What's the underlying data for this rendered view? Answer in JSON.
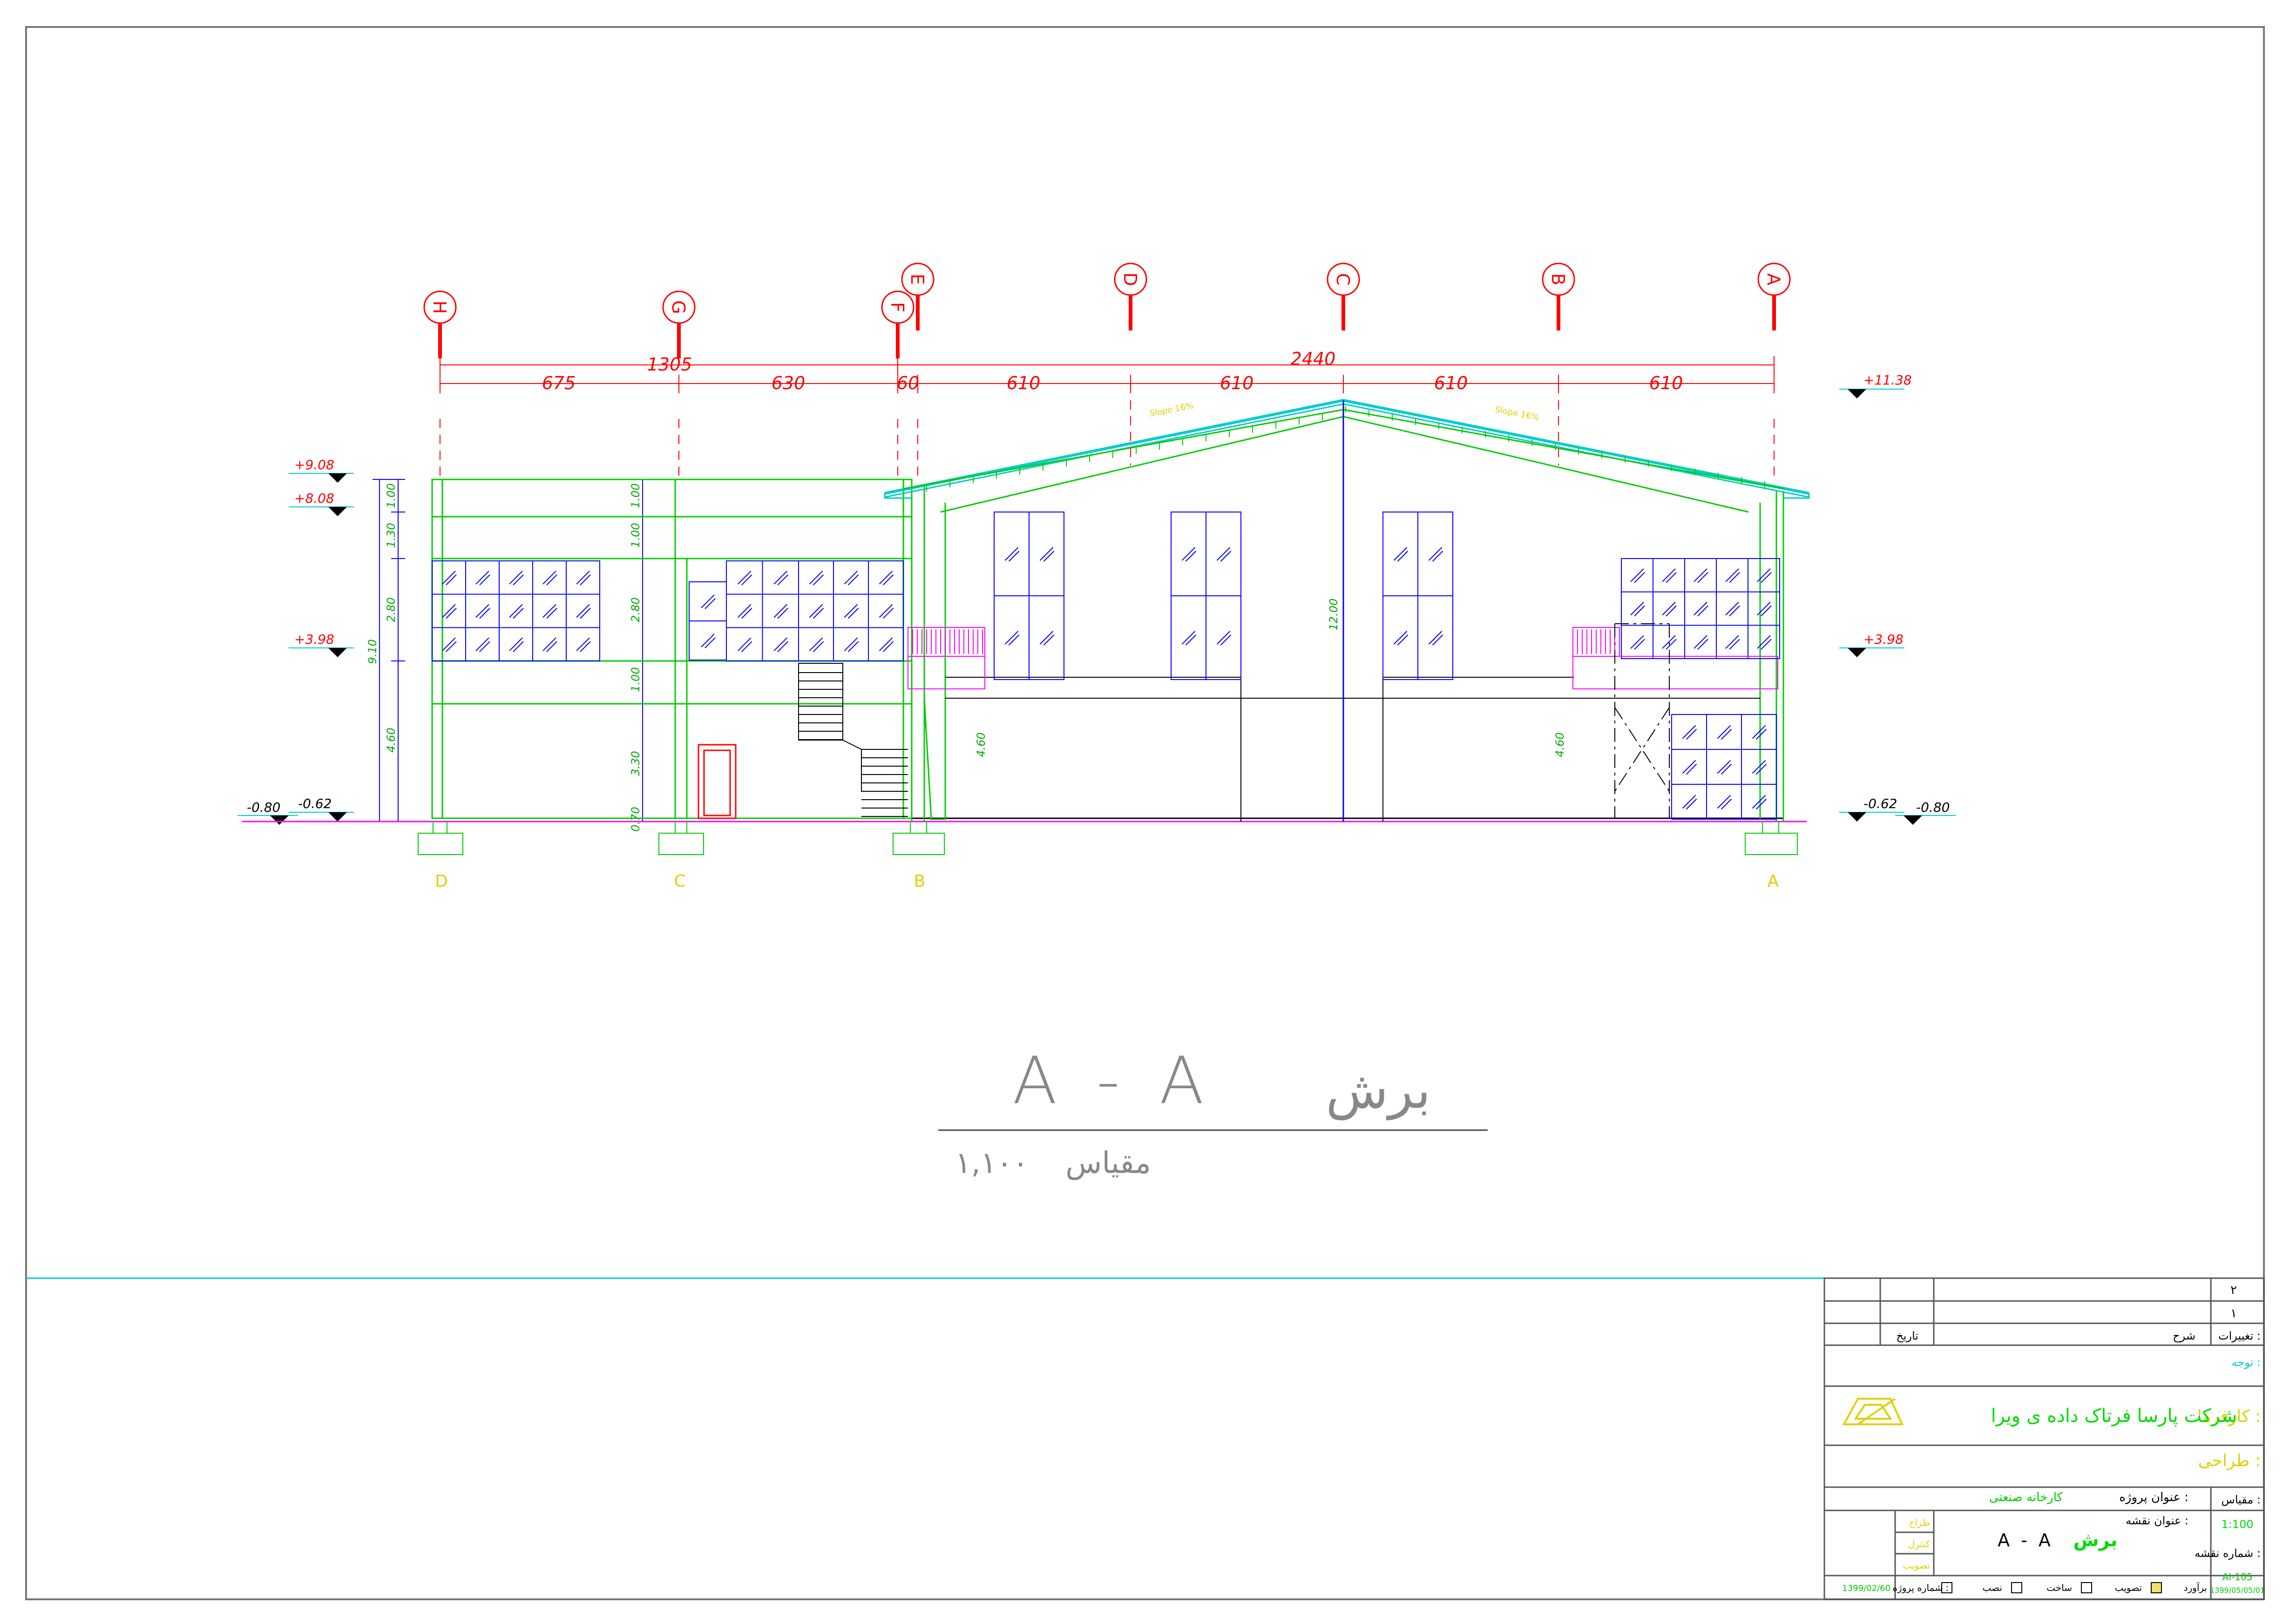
{
  "grid_top": [
    {
      "id": "grid-h",
      "label": "H"
    },
    {
      "id": "grid-g",
      "label": "G"
    },
    {
      "id": "grid-f",
      "label": "F"
    },
    {
      "id": "grid-e",
      "label": "E"
    },
    {
      "id": "grid-d",
      "label": "D"
    },
    {
      "id": "grid-c",
      "label": "C"
    },
    {
      "id": "grid-b",
      "label": "B"
    },
    {
      "id": "grid-a",
      "label": "A"
    }
  ],
  "grid_bottom": [
    {
      "id": "axis-d",
      "label": "D"
    },
    {
      "id": "axis-c",
      "label": "C"
    },
    {
      "id": "axis-b",
      "label": "B"
    },
    {
      "id": "axis-a",
      "label": "A"
    }
  ],
  "dimensions": {
    "total_left": "1305",
    "total_right": "2440",
    "spans": [
      "675",
      "630",
      "60",
      "610",
      "610",
      "610",
      "610"
    ],
    "vertical_total": "9.10",
    "vertical_parts": [
      "1.00",
      "1.30",
      "2.80",
      "4.60"
    ],
    "vertical_mid": [
      "1.00",
      "1.00",
      "2.80",
      "1.00",
      "3.30",
      "0.70"
    ],
    "height_main": "12.00",
    "height_inner_left": "4.60",
    "height_inner_right": "4.60"
  },
  "levels": {
    "left": [
      "+9.08",
      "+8.08",
      "+3.98",
      "-0.62",
      "-0.80"
    ],
    "right": [
      "+11.38",
      "+3.98",
      "-0.62",
      "-0.80"
    ]
  },
  "roof_slope": [
    "Slope 16%",
    "Slope 16%"
  ],
  "drawing_title": {
    "section": "A - A",
    "label": "برش",
    "scale_label": "مقیاس",
    "scale_value": "۱,۱۰۰"
  },
  "title_block": {
    "rev_rows": [
      "۲",
      "۱"
    ],
    "changes_label": "تغییرات :",
    "desc_label": "شرح",
    "date_label": "تاریخ",
    "notes_label": "توجه :",
    "owner_label": "کارفرما :",
    "owner_value": "شرکت پارسا فرتاک داده ی ویرا",
    "designer_label": "طراحی :",
    "scale_label": "مقیاس :",
    "scale_value": "1:100",
    "project_title_label": "عنوان پروژه :",
    "project_title_value": "کارخانه صنعتی",
    "sheet_title_label": "عنوان نقشه :",
    "sheet_title_value": "برش",
    "sheet_title_section": "A - A",
    "sheet_no_label": "شماره نقشه :",
    "sheet_no_value": "AI-105",
    "sheet_date": "1399/05/05/01",
    "side_labels": [
      "طراح",
      "کنترل",
      "تصویب"
    ],
    "project_no_label": "شماره پروژه :",
    "project_no_value": "1399/02/60",
    "stages": [
      "برآورد",
      "تصویب",
      "ساخت",
      "نصب"
    ]
  },
  "colors": {
    "red": "#ff0000",
    "green": "#00dd00",
    "cyan": "#00cccc",
    "blue": "#0000ff",
    "magenta": "#ff00ff",
    "yellow": "#e0d000",
    "black": "#000000",
    "grey": "#888888"
  }
}
